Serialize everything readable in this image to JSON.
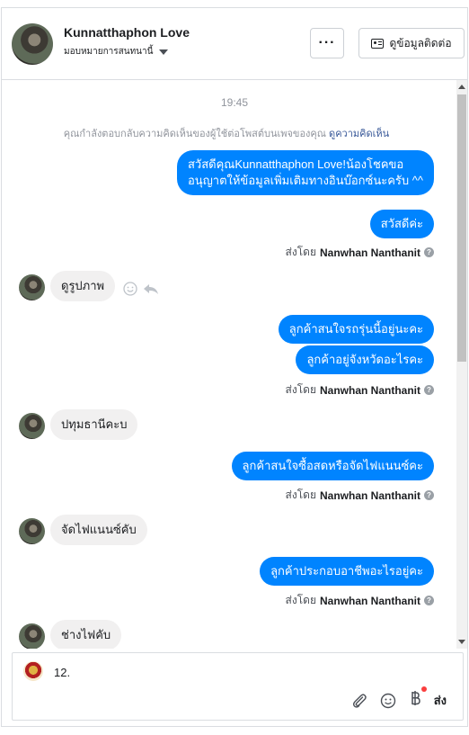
{
  "header": {
    "name": "Kunnatthaphon Love",
    "assign_label": "มอบหมายการสนทนานี้",
    "more_label": "···",
    "contact_label": "ดูข้อมูลติดต่อ"
  },
  "chat": {
    "time": "19:45",
    "notice_text": "คุณกำลังตอบกลับความคิดเห็นของผู้ใช้ต่อโพสต์บนเพจของคุณ",
    "notice_link": "ดูความคิดเห็น",
    "messages": [
      {
        "dir": "out",
        "text": "สวัสดีคุณKunnatthaphon Love!น้องโชคขออนุญาตให้ข้อมูลเพิ่มเติมทางอินบ๊อกซ์นะครับ ^^"
      },
      {
        "dir": "out",
        "text": "สวัสดีค่ะ"
      },
      {
        "dir": "sent_by",
        "label": "ส่งโดย",
        "name": "Nanwhan Nanthanit"
      },
      {
        "dir": "in",
        "text": "ดูรูปภาพ"
      },
      {
        "dir": "out",
        "text": "ลูกค้าสนใจรถรุ่นนี้อยู่นะคะ"
      },
      {
        "dir": "out",
        "text": "ลูกค้าอยู่จังหวัดอะไรคะ"
      },
      {
        "dir": "sent_by",
        "label": "ส่งโดย",
        "name": "Nanwhan Nanthanit"
      },
      {
        "dir": "in",
        "text": "ปทุมธานีคะบ"
      },
      {
        "dir": "out",
        "text": "ลูกค้าสนใจซื้อสดหรือจัดไฟแนนซ์คะ"
      },
      {
        "dir": "sent_by",
        "label": "ส่งโดย",
        "name": "Nanwhan Nanthanit"
      },
      {
        "dir": "in",
        "text": "จัดไฟแนนซ์คับ"
      },
      {
        "dir": "out",
        "text": "ลูกค้าประกอบอาชีพอะไรอยู่คะ"
      },
      {
        "dir": "sent_by",
        "label": "ส่งโดย",
        "name": "Nanwhan Nanthanit"
      },
      {
        "dir": "in",
        "text": "ช่างไฟคับ"
      }
    ]
  },
  "composer": {
    "value": "12.",
    "send_label": "ส่ง"
  },
  "colors": {
    "outgoing_bubble": "#0084ff",
    "incoming_bubble": "#f1f0f0",
    "link": "#385898"
  }
}
